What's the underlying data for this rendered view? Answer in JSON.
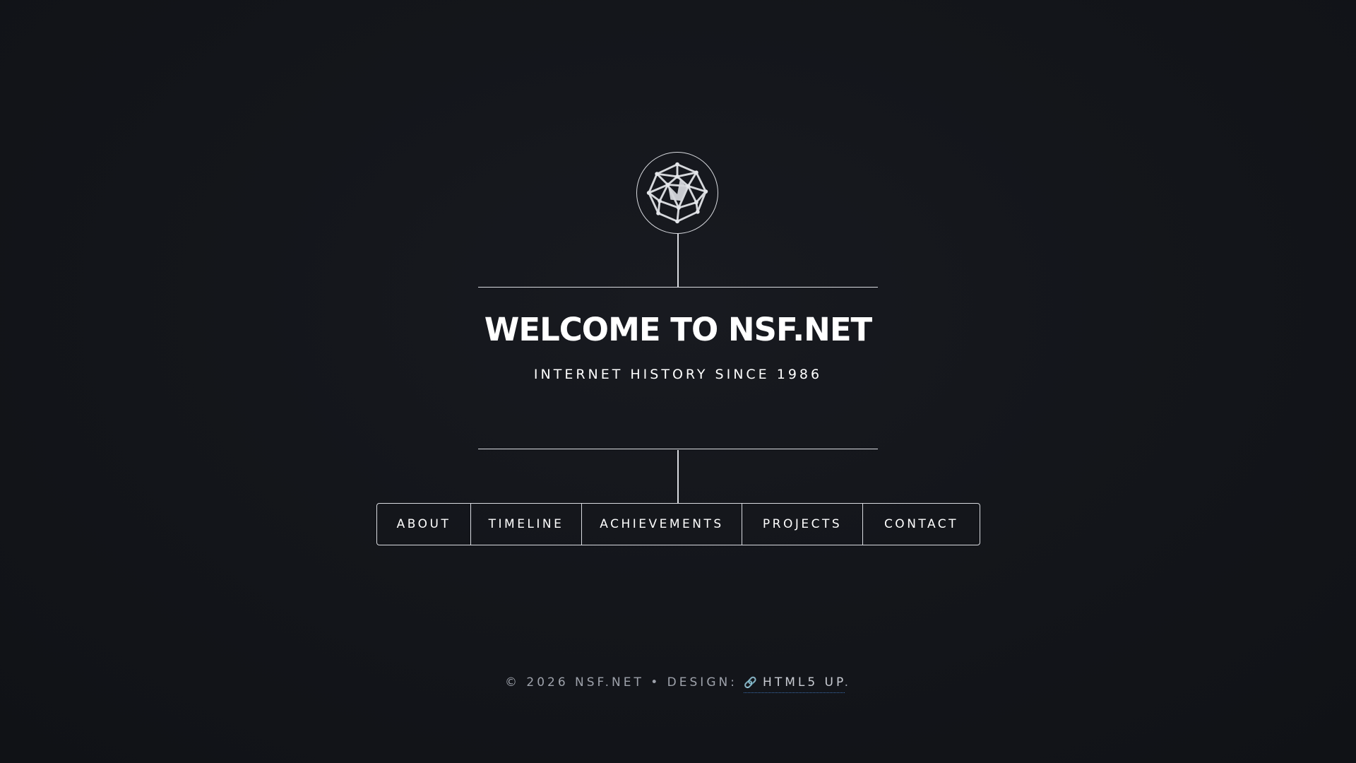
{
  "header": {
    "title": "WELCOME TO NSF.NET",
    "subtitle": "INTERNET HISTORY SINCE 1986",
    "logo_icon": "network-globe-icon"
  },
  "nav": {
    "items": [
      {
        "label": "ABOUT"
      },
      {
        "label": "TIMELINE"
      },
      {
        "label": "ACHIEVEMENTS"
      },
      {
        "label": "PROJECTS"
      },
      {
        "label": "CONTACT"
      }
    ]
  },
  "footer": {
    "copyright": "© 2026 NSF.NET • DESIGN: ",
    "link_icon": "link-icon",
    "link_label": "HTML5 UP",
    "suffix": "."
  },
  "colors": {
    "background": "#14161b",
    "line": "#d9dbe0",
    "link_accent": "#3d7ed6"
  }
}
